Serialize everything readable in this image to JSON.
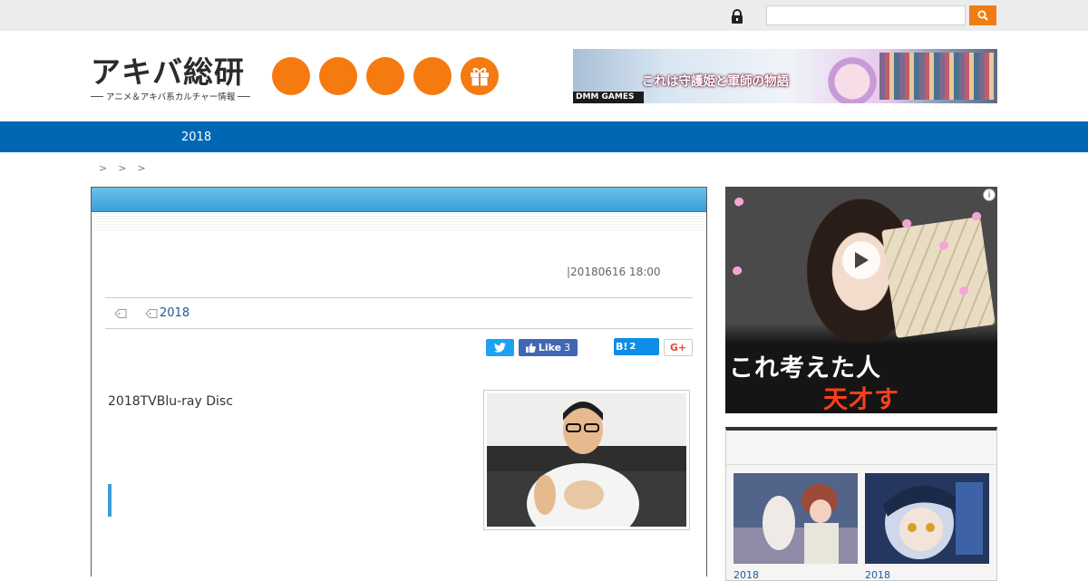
{
  "topbar": {
    "search_placeholder": "",
    "lock_icon": "lock-icon",
    "search_icon": "search-icon"
  },
  "brand": {
    "logo_main": "アキバ総研",
    "logo_sub": "アニメ＆アキバ系カルチャー情報",
    "accent_color": "#f57a10"
  },
  "header_icons": [
    "circle-icon",
    "circle-icon",
    "circle-icon",
    "circle-icon",
    "gift-icon"
  ],
  "banner_top": {
    "title": "これは守護姫と軍師の物語",
    "brand": "DMM GAMES"
  },
  "nav": {
    "color": "#0068b3",
    "items": [
      {
        "label": "2018"
      }
    ]
  },
  "breadcrumb": {
    "separators": [
      ">",
      ">",
      ">"
    ]
  },
  "article": {
    "date": "|20180616 18:00",
    "tag_link": "2018",
    "share": {
      "facebook_label": "Like",
      "facebook_count": "3",
      "hatena_label": "B!",
      "hatena_count": "2",
      "gplus_label": "G+"
    },
    "lead_text": "2018TVBlu-ray Disc"
  },
  "side_ad": {
    "line1": "これ考えた人",
    "line2": "天才すぎ・・・",
    "info": "i"
  },
  "side_box": {
    "title": "",
    "items": [
      {
        "caption": "2018"
      },
      {
        "caption": "2018"
      }
    ]
  }
}
